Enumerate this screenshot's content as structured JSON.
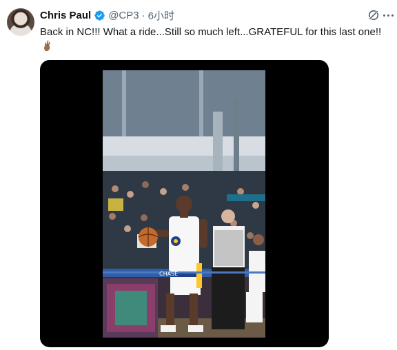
{
  "tweet": {
    "display_name": "Chris Paul",
    "handle": "@CP3",
    "separator": "·",
    "time": "6小时",
    "text": "Back in NC!!! What a ride...Still so much left...GRATEFUL for this last one!!",
    "emoji": "crossed-fingers-emoji"
  },
  "colors": {
    "verified": "#1d9bf0",
    "muted_text": "#536471",
    "jersey_blue": "#1d428a",
    "jersey_gold": "#ffc72c"
  },
  "media": {
    "type": "video",
    "scoreboard_text": "CHASE"
  }
}
